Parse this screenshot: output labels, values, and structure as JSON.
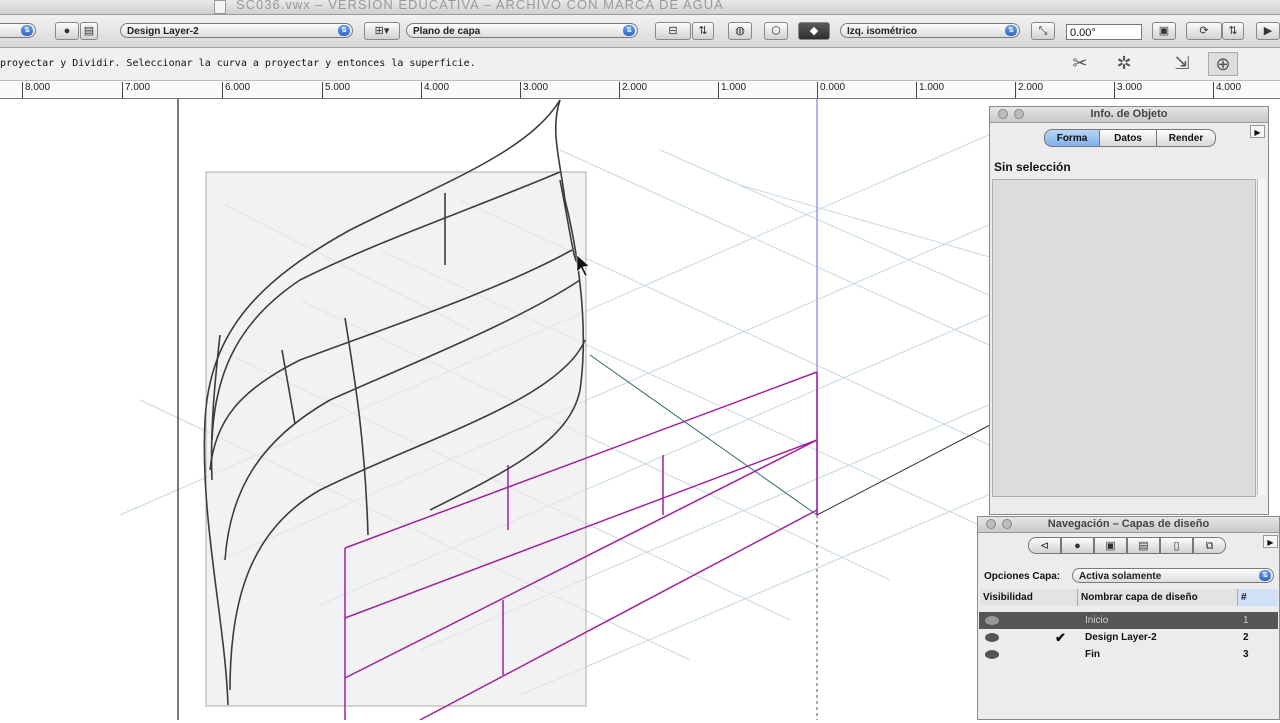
{
  "window": {
    "title": "SC036.vwx – VERSIÓN EDUCATIVA – ARCHIVO CON MARCA DE AGUA"
  },
  "toolbar": {
    "layer_select": "Design Layer-2",
    "plane_select": "Plano de capa",
    "view_select": "Izq. isométrico",
    "angle_value": "0.00°"
  },
  "message": {
    "text": "proyectar y Dividir. Seleccionar la curva a proyectar y entonces la superficie."
  },
  "ruler": {
    "labels": [
      "8.000",
      "7.000",
      "6.000",
      "5.000",
      "4.000",
      "3.000",
      "2.000",
      "1.000",
      "0.000",
      "1.000",
      "2.000",
      "3.000",
      "4.000"
    ]
  },
  "object_info": {
    "title": "Info. de Objeto",
    "tabs": [
      "Forma",
      "Datos",
      "Render"
    ],
    "active_tab": "Forma",
    "status": "Sin selección"
  },
  "navigation": {
    "title": "Navegación – Capas de diseño",
    "options_label": "Opciones Capa:",
    "options_value": "Activa solamente",
    "col_visibility": "Visibilidad",
    "col_name": "Nombrar capa de diseño",
    "col_num": "#",
    "layers": [
      {
        "name": "Inicio",
        "num": "1",
        "active": false
      },
      {
        "name": "Design Layer-2",
        "num": "2",
        "active": true
      },
      {
        "name": "Fin",
        "num": "3",
        "active": false
      }
    ]
  },
  "icons": {
    "toolbar": [
      "class-icon",
      "layer-icon",
      "plane-icon",
      "view-icon",
      "render-icon",
      "snap-icon",
      "stack-icon"
    ],
    "message_tools": [
      "split-tool-icon",
      "gear-icon",
      "project-icon",
      "mode-icon"
    ]
  },
  "colors": {
    "magenta_geometry": "#a020a0",
    "axis_blue": "#9a9ae0",
    "grid": "#c7d8e4"
  }
}
